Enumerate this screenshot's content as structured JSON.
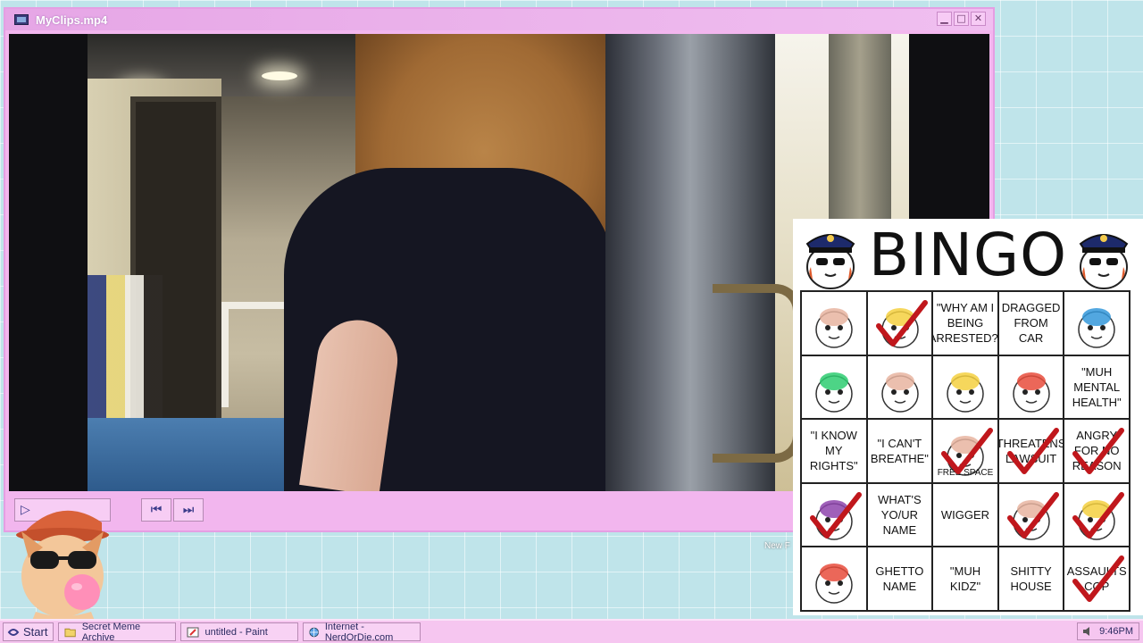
{
  "player": {
    "title": "MyClips.mp4",
    "buttons": {
      "minimize": "▁",
      "maximize": "□",
      "close": "✕"
    },
    "controls": {
      "play": "▷",
      "prev": "⏮",
      "next": "⏭"
    }
  },
  "bingo": {
    "title": "BINGO",
    "cells": [
      {
        "text": "",
        "checked": false,
        "icon": "cat-girl-sticker"
      },
      {
        "text": "",
        "checked": true,
        "icon": "woman-face-photo"
      },
      {
        "text": "\"WHY AM I BEING ARRESTED?\"",
        "checked": false
      },
      {
        "text": "DRAGGED FROM CAR",
        "checked": false
      },
      {
        "text": "",
        "checked": false,
        "icon": "sketch-drawing"
      },
      {
        "text": "",
        "checked": false,
        "icon": "crying-character-sticker"
      },
      {
        "text": "",
        "checked": false,
        "icon": "cat-driving-sticker"
      },
      {
        "text": "",
        "checked": false,
        "icon": "red-hair-character-sticker"
      },
      {
        "text": "",
        "checked": false,
        "icon": "cat-sticker"
      },
      {
        "text": "\"MUH MENTAL HEALTH\"",
        "checked": false
      },
      {
        "text": "\"I KNOW MY RIGHTS\"",
        "checked": false
      },
      {
        "text": "\"I CAN'T BREATHE\"",
        "checked": false
      },
      {
        "text": "",
        "checked": true,
        "free": "FREE SPACE",
        "icon": "free-space-badge"
      },
      {
        "text": "THREATENS LAWSUIT",
        "checked": true
      },
      {
        "text": "ANGRY FOR NO REASON",
        "checked": true
      },
      {
        "text": "",
        "checked": true,
        "icon": "clown-cat-sticker"
      },
      {
        "text": "WHAT'S YO/UR NAME",
        "checked": false
      },
      {
        "text": "WIGGER",
        "checked": false
      },
      {
        "text": "",
        "checked": true,
        "icon": "cat-police-sticker"
      },
      {
        "text": "",
        "checked": true,
        "icon": "cat-yelling-sticker"
      },
      {
        "text": "",
        "checked": false,
        "icon": "fat-cat-sticker"
      },
      {
        "text": "GHETTO NAME",
        "checked": false
      },
      {
        "text": "\"MUH KIDZ\"",
        "checked": false
      },
      {
        "text": "SHITTY HOUSE",
        "checked": false
      },
      {
        "text": "ASSAULTS COP",
        "checked": true
      }
    ]
  },
  "desktop": {
    "icon_label": "New F"
  },
  "taskbar": {
    "start": "Start",
    "items": [
      {
        "label": "Secret Meme Archive",
        "icon": "folder-icon"
      },
      {
        "label": "untitled - Paint",
        "icon": "paint-icon"
      },
      {
        "label": "Internet - NerdOrDie.com",
        "icon": "browser-icon"
      }
    ],
    "clock": "9:46PM"
  },
  "colors": {
    "accent": "#f2b6ee",
    "check": "#c0171c",
    "desktop": "#bfe4ea"
  }
}
